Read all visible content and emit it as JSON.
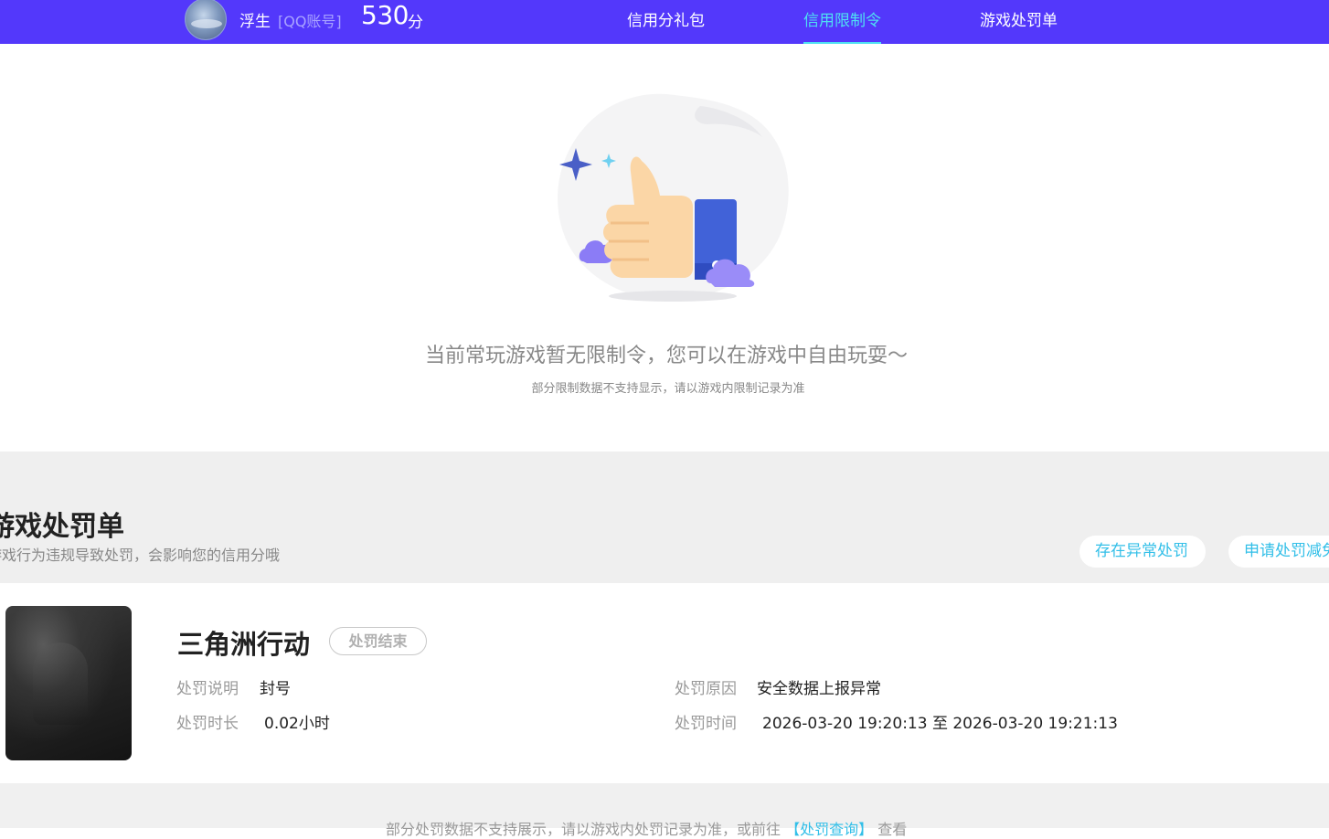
{
  "header": {
    "nickname": "浮生",
    "account_type": "[QQ账号]",
    "score": "530",
    "score_unit": "分",
    "tabs": [
      {
        "label": "信用分礼包",
        "active": false
      },
      {
        "label": "信用限制令",
        "active": true
      },
      {
        "label": "游戏处罚单",
        "active": false
      }
    ]
  },
  "empty_state": {
    "title": "当前常玩游戏暂无限制令，您可以在游戏中自由玩耍～",
    "subtitle": "部分限制数据不支持显示，请以游戏内限制记录为准"
  },
  "penalty": {
    "section_title": "游戏处罚单",
    "section_desc": "游戏行为违规导致处罚，会影响您的信用分哦",
    "actions": [
      "存在异常处罚",
      "申请处罚减免"
    ],
    "record": {
      "game_name": "三角洲行动",
      "status": "处罚结束",
      "desc_label": "处罚说明",
      "desc_value": "封号",
      "reason_label": "处罚原因",
      "reason_value": "安全数据上报异常",
      "duration_label": "处罚时长",
      "duration_value": "0.02小时",
      "time_label": "处罚时间",
      "time_value": "2026-03-20 19:20:13 至 2026-03-20 19:21:13"
    },
    "footer_note": "部分处罚数据不支持展示，请以游戏内处罚记录为准，或前往",
    "footer_link": "【处罚查询】",
    "footer_suffix": "查看"
  },
  "colors": {
    "brand": "#5338fb",
    "accent": "#4fe0f2",
    "link": "#32bfe8"
  }
}
